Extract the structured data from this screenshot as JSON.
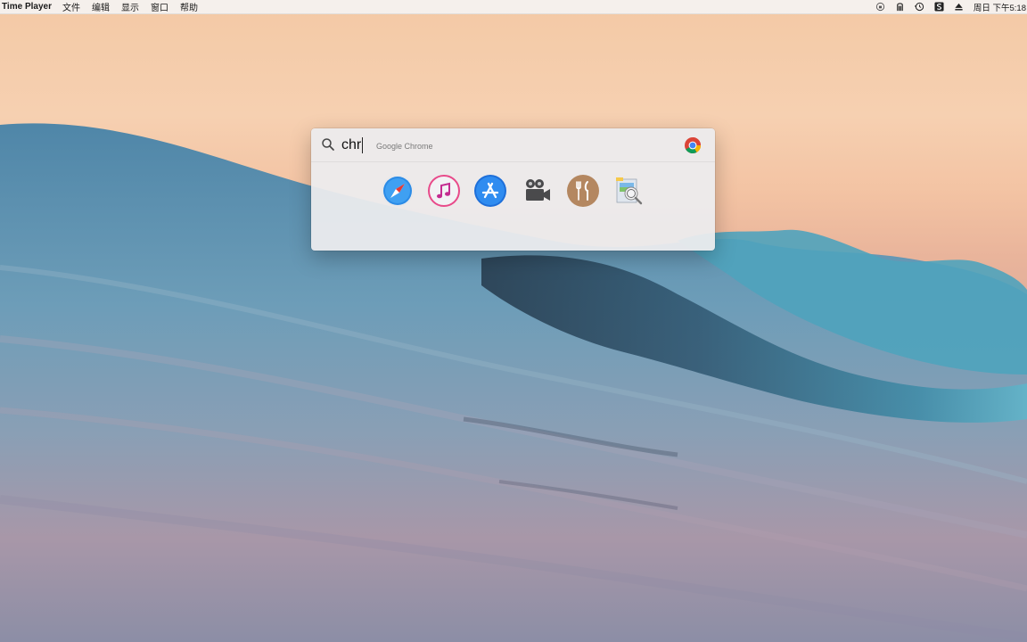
{
  "menubar": {
    "app_name": "Time Player",
    "menus": [
      "文件",
      "编辑",
      "显示",
      "窗口",
      "帮助"
    ],
    "status_icons": [
      "lock-icon",
      "acrobat-icon",
      "time-machine-icon",
      "dollar-icon",
      "eject-icon"
    ],
    "clock": "周日 下午5:18"
  },
  "spotlight": {
    "query": "chr",
    "completion": "Google Chrome",
    "top_hit_icon": "chrome-icon",
    "apps": [
      {
        "name": "safari-icon"
      },
      {
        "name": "itunes-icon"
      },
      {
        "name": "app-store-icon"
      },
      {
        "name": "movie-camera-icon"
      },
      {
        "name": "restaurant-icon"
      },
      {
        "name": "preview-icon"
      }
    ]
  },
  "colors": {
    "sky": "#f3c9a5",
    "wave_light": "#7fb3c9",
    "wave_dark": "#2f4a5c",
    "spotlight_bg": "#ececee"
  }
}
